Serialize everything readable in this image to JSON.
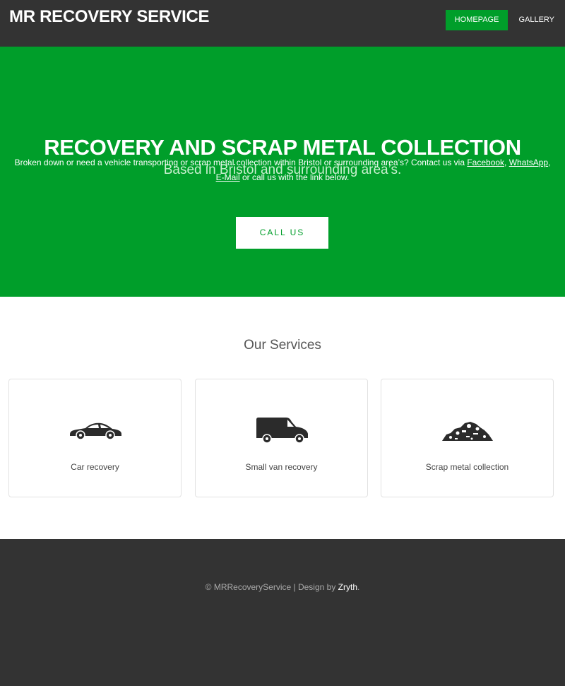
{
  "header": {
    "brand": "MR RECOVERY SERVICE",
    "nav": [
      {
        "label": "HOMEPAGE",
        "active": true
      },
      {
        "label": "GALLERY",
        "active": false
      }
    ]
  },
  "hero": {
    "title": "RECOVERY AND SCRAP METAL COLLECTION",
    "subtitle": "Based in Bristol and surrounding area’s.",
    "blurb_before": "Broken down or need a vehicle transporting or scrap metal collection within Bristol or surrounding area’s? Contact us via ",
    "link_facebook": "Facebook",
    "sep1": ", ",
    "link_whatsapp": "WhatsApp",
    "sep2": ",",
    "link_email": "E-Mail",
    "blurb_after": " or call us with the link below.",
    "cta_label": "CALL US"
  },
  "services": {
    "heading": "Our Services",
    "items": [
      {
        "label": "Car recovery",
        "icon": "car-icon"
      },
      {
        "label": "Small van recovery",
        "icon": "van-icon"
      },
      {
        "label": "Scrap metal collection",
        "icon": "scrap-pile-icon"
      }
    ]
  },
  "footer": {
    "prefix": "© MRRecoveryService | Design by ",
    "author": "Zryth",
    "suffix": "."
  },
  "colors": {
    "brand_green": "#009e2a",
    "dark": "#333333"
  }
}
